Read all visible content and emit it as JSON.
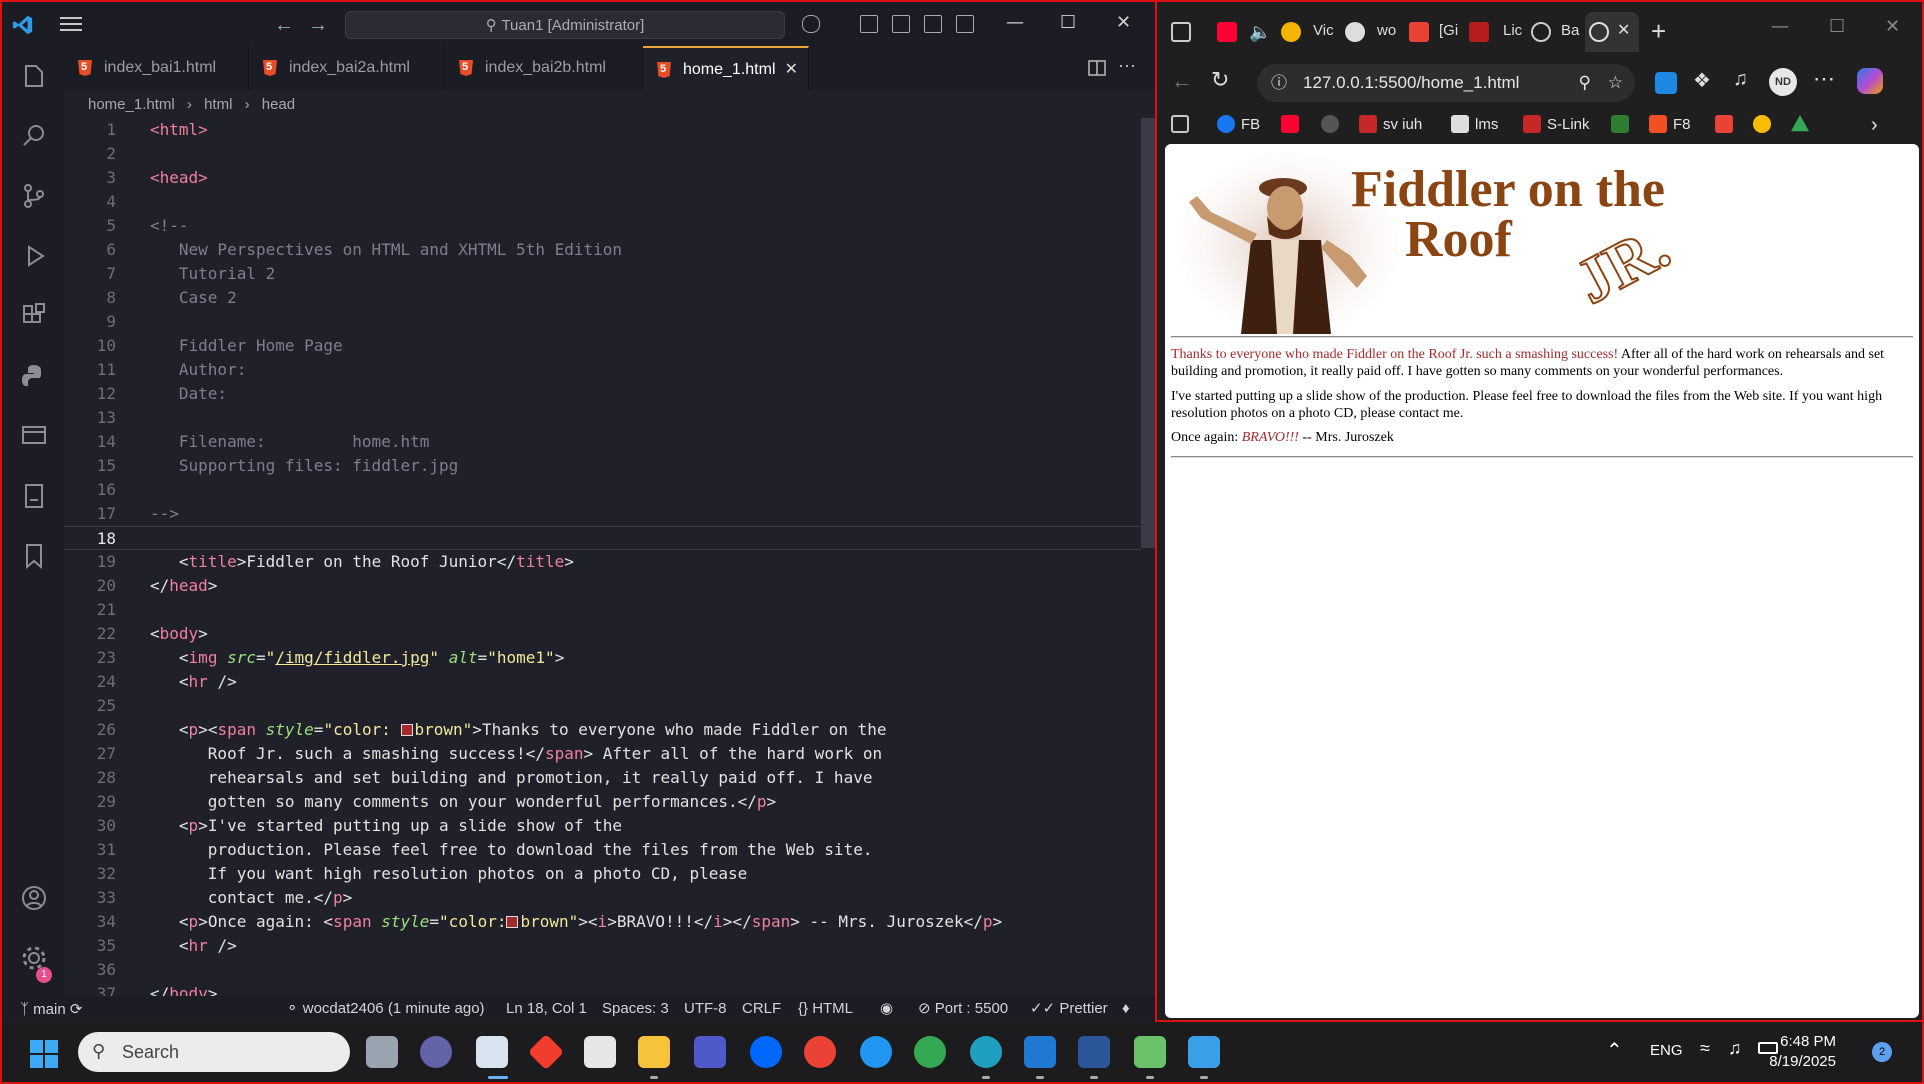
{
  "vscode": {
    "search": "Tuan1 [Administrator]",
    "tabs": [
      {
        "label": "index_bai1.html"
      },
      {
        "label": "index_bai2a.html"
      },
      {
        "label": "index_bai2b.html"
      },
      {
        "label": "home_1.html"
      }
    ],
    "breadcrumb": [
      "home_1.html",
      "html",
      "head"
    ],
    "status": {
      "branch": "main",
      "commit": "wocdat2406 (1 minute ago)",
      "position": "Ln 18, Col 1",
      "spaces": "Spaces: 3",
      "encoding": "UTF-8",
      "eol": "CRLF",
      "language": "HTML",
      "port": "Port : 5500",
      "formatter": "Prettier"
    },
    "settings_badge": "1"
  },
  "code": {
    "l1": "<html>",
    "l3": "<head>",
    "l5": "<!--",
    "l6": "   New Perspectives on HTML and XHTML 5th Edition",
    "l7": "   Tutorial 2",
    "l8": "   Case 2",
    "l10": "   Fiddler Home Page",
    "l11": "   Author:",
    "l12": "   Date:",
    "l14": "   Filename:         home.htm",
    "l15": "   Supporting files: fiddler.jpg",
    "l17": "-->",
    "l19_title_text": "Fiddler on the Roof Junior",
    "l23_src": "/img/fiddler.jpg",
    "l23_alt": "home1",
    "l26_text": "Thanks to everyone who made Fiddler on the",
    "l27": "Roof Jr. such a smashing success!",
    "l27_after": " After all of the hard work on",
    "l28": "      rehearsals and set building and promotion, it really paid off. I have",
    "l29": "      gotten so many comments on your wonderful performances.",
    "l30": "I've started putting up a slide show of the",
    "l31": "      production. Please feel free to download the files from the Web site.",
    "l32": "      If you want high resolution photos on a photo CD, please",
    "l33": "      contact me.",
    "l34_a": "Once again: ",
    "l34_b": "BRAVO!!!",
    "l34_c": " -- Mrs. Juroszek"
  },
  "browser": {
    "tab_labels": [
      "Vic",
      "wo",
      "[Gi",
      "Lic",
      "Ba"
    ],
    "url": "127.0.0.1:5500/home_1.html",
    "profile": "ND",
    "bookmarks": [
      "FB",
      "sv iuh",
      "lms",
      "S-Link",
      "F8"
    ]
  },
  "page": {
    "logo_line1": "Fiddler on the",
    "logo_line2": "Roof",
    "logo_jr": "JR.",
    "p1_brown": "Thanks to everyone who made Fiddler on the Roof Jr. such a smashing success!",
    "p1_rest": " After all of the hard work on rehearsals and set building and promotion, it really paid off. I have gotten so many comments on your wonderful performances.",
    "p2": "I've started putting up a slide show of the production. Please feel free to download the files from the Web site. If you want high resolution photos on a photo CD, please contact me.",
    "p3_a": "Once again: ",
    "p3_b": "BRAVO!!!",
    "p3_c": " -- Mrs. Juroszek"
  },
  "taskbar": {
    "search": "Search",
    "language": "ENG",
    "time": "6:48 PM",
    "date": "8/19/2025",
    "notifications": "2"
  },
  "colors": {
    "brown": "#a52a2a",
    "vscode_bg": "#1f2029",
    "accent_tab": "#e8a33d"
  }
}
